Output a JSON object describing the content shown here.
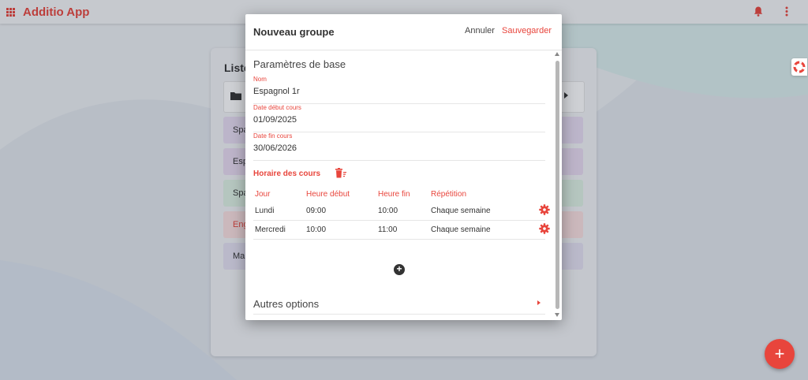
{
  "app": {
    "title": "Additio App"
  },
  "background_card": {
    "title": "Liste",
    "groups": [
      {
        "label": "Spa",
        "color": "#e8ddf3"
      },
      {
        "label": "Esp",
        "color": "#eadcf1"
      },
      {
        "label": "Spa",
        "color": "#dff2e4"
      },
      {
        "label": "Eng",
        "color": "#fbe1e0"
      },
      {
        "label": "Ma",
        "color": "#e6e2f3"
      }
    ]
  },
  "modal": {
    "title": "Nouveau groupe",
    "cancel_label": "Annuler",
    "save_label": "Sauvegarder",
    "basic_section_title": "Paramètres de base",
    "fields": [
      {
        "label": "Nom",
        "value": "Espagnol 1r"
      },
      {
        "label": "Date début cours",
        "value": "01/09/2025"
      },
      {
        "label": "Date fin cours",
        "value": "30/06/2026"
      }
    ],
    "schedule": {
      "title": "Horaire des cours",
      "headers": [
        "Jour",
        "Heure début",
        "Heure fin",
        "Répétition"
      ],
      "rows": [
        {
          "day": "Lundi",
          "start": "09:00",
          "end": "10:00",
          "repeat": "Chaque semaine"
        },
        {
          "day": "Mercredi",
          "start": "10:00",
          "end": "11:00",
          "repeat": "Chaque semaine"
        }
      ]
    },
    "other_options_label": "Autres options"
  },
  "colors": {
    "accent": "#e8453c"
  }
}
